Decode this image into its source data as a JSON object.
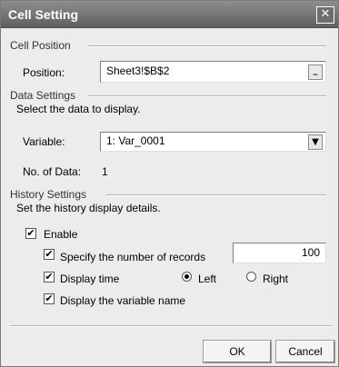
{
  "dialog": {
    "title": "Cell Setting",
    "close_glyph": "✕"
  },
  "cell_position": {
    "group_label": "Cell Position",
    "position_label": "Position:",
    "position_value": "Sheet3!$B$2",
    "browse_glyph": "_"
  },
  "data_settings": {
    "group_label": "Data Settings",
    "description": "Select the data to display.",
    "variable_label": "Variable:",
    "variable_value": "1: Var_0001",
    "dropdown_glyph": "▼",
    "count_label": "No. of Data:",
    "count_value": "1"
  },
  "history_settings": {
    "group_label": "History Settings",
    "description": "Set the history display details.",
    "enable_label": "Enable",
    "enable_checked": true,
    "records_label": "Specify the number of records",
    "records_checked": true,
    "records_value": "100",
    "time_label": "Display time",
    "time_checked": true,
    "left_label": "Left",
    "right_label": "Right",
    "selected_side": "Left",
    "varname_label": "Display the variable name",
    "varname_checked": true,
    "check_glyph": "✔"
  },
  "buttons": {
    "ok_label": "OK",
    "cancel_label": "Cancel"
  }
}
